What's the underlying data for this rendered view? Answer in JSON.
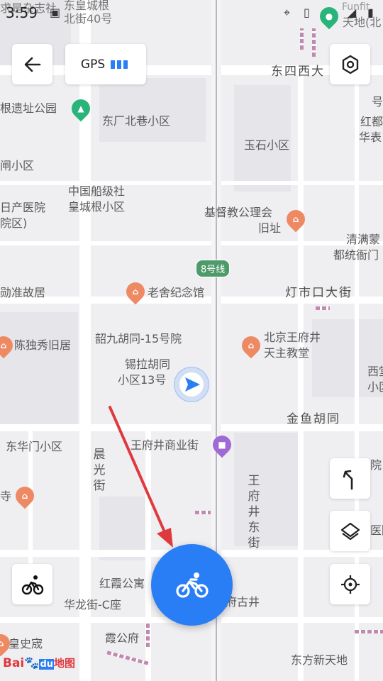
{
  "status_bar": {
    "time": "3:59",
    "carrier_text": "Funfit"
  },
  "top_bar": {
    "back": "back-arrow-icon",
    "gps_label": "GPS",
    "settings": "hexagon-settings-icon"
  },
  "map": {
    "roads": {
      "dongsi_west": "东四西大",
      "dengshikou": "灯市口大街",
      "jinyu": "金鱼胡同",
      "chenguang": "晨光街",
      "wangfujing": "王府井东街",
      "huayang": "东方新天地"
    },
    "places": {
      "top_left_1": "求是杂志社",
      "top_left_2": "东皇城根",
      "top_left_3": "北街40号",
      "top_right": "天地(北",
      "p1": "根遗址公园",
      "p2": "东厂北巷小区",
      "p3": "玉石小区",
      "p4": "闸小区",
      "p5a": "中国船级社",
      "p5b": "皇城根小区",
      "p6a": "日产医院",
      "p6b": "院区)",
      "p7a": "基督教公理会",
      "p7b": "旧址",
      "p8": "老舍纪念馆",
      "p9": "勋准故居",
      "p10": "韶九胡同-15号院",
      "p11a": "北京王府井",
      "p11b": "天主教堂",
      "p12": "陈独秀旧居",
      "p13a": "锡拉胡同",
      "p13b": "小区13号",
      "p14": "东华门小区",
      "p15": "王府井商业街",
      "p16": "寺",
      "p17": "红霞公寓",
      "p18": "华龙街-C座",
      "p19": "府古井",
      "p20": "霞公府",
      "p21": "皇史宬",
      "p22a": "清满蒙",
      "p22b": "都统衙门",
      "p23a": "号",
      "p23b": "红都",
      "p23c": "华表",
      "p24a": "西堂",
      "p24b": "小区",
      "p25": "东方新天地",
      "p26": "院",
      "p27": "医院"
    },
    "metro_badge": "8号线"
  },
  "right_controls": {
    "navigate": "turn-arrow-icon",
    "layers": "layers-icon",
    "locate": "locate-icon"
  },
  "left_controls": {
    "ride_mode": "cyclist-icon"
  },
  "main_action": {
    "icon": "bicycle-icon"
  },
  "brand": {
    "logo_text_1": "Bai",
    "logo_text_2": "du",
    "logo_text_3": "地图"
  },
  "colors": {
    "accent": "#2a7ef5",
    "annotation_arrow": "#e0393d"
  }
}
